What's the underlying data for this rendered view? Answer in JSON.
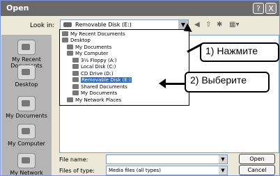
{
  "window": {
    "title": "Open",
    "help_label": "?",
    "close_label": "X"
  },
  "look_in": {
    "label": "Look in:",
    "value": "Removable Disk (E:)"
  },
  "toolbar": {
    "back": "◀",
    "up": "⇧",
    "new_folder": "✱",
    "view": "▦▾"
  },
  "places": [
    {
      "label": "My Recent Documents",
      "icon": "recent-docs-icon"
    },
    {
      "label": "Desktop",
      "icon": "desktop-icon"
    },
    {
      "label": "My Documents",
      "icon": "documents-icon"
    },
    {
      "label": "My Computer",
      "icon": "computer-icon"
    },
    {
      "label": "My Network",
      "icon": "network-icon"
    }
  ],
  "dropdown_items": [
    {
      "label": "My Recent Documents"
    },
    {
      "label": "Desktop"
    },
    {
      "label": "My Documents"
    },
    {
      "label": "My Computer"
    },
    {
      "label": "3½ Floppy (A:)"
    },
    {
      "label": "Local Disk (C:)"
    },
    {
      "label": "CD Drive (D:)"
    },
    {
      "label": "Removable Disk (E:)",
      "selected": true
    },
    {
      "label": "Shared Documents"
    },
    {
      "label": "My Documents"
    },
    {
      "label": "My Network Places"
    }
  ],
  "file_name": {
    "label": "File name:",
    "value": ""
  },
  "files_of_type": {
    "label": "Files of type:",
    "value": "Media files (all types)"
  },
  "buttons": {
    "open": "Open",
    "cancel": "Cancel"
  },
  "annotations": {
    "one": "1) Нажмите",
    "two": "2)  Выберите"
  }
}
